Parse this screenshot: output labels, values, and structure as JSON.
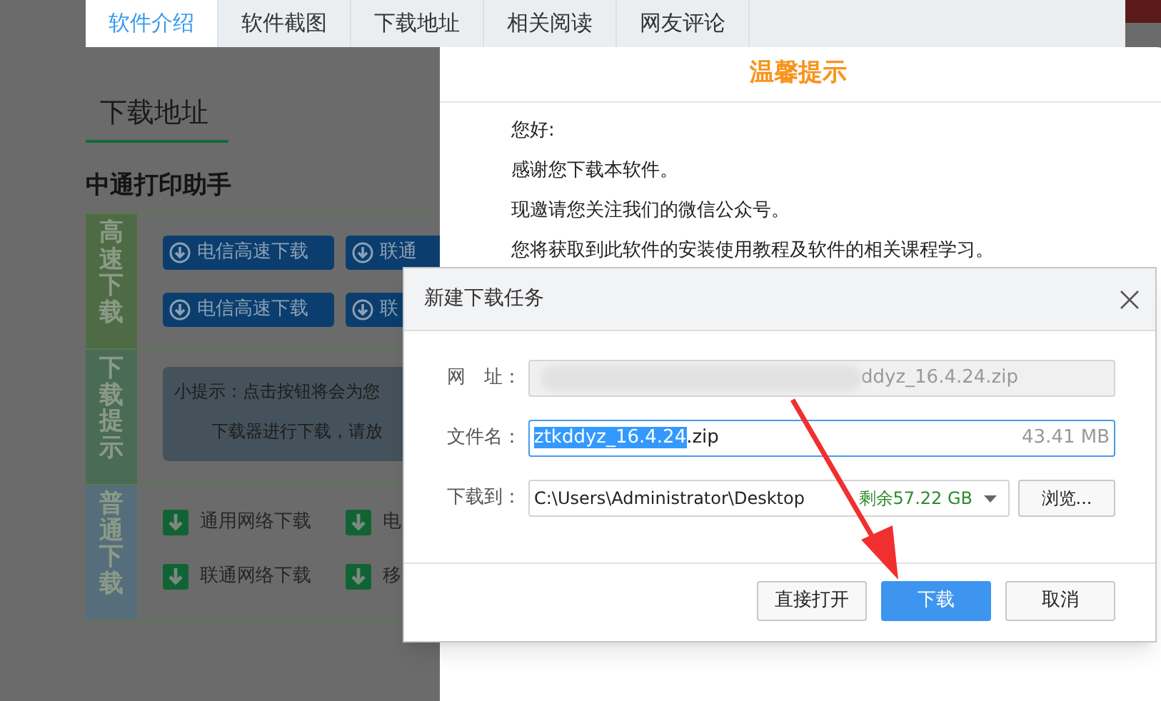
{
  "tabs": [
    {
      "label": "软件介绍",
      "selected": true
    },
    {
      "label": "软件截图",
      "selected": false
    },
    {
      "label": "下载地址",
      "selected": false
    },
    {
      "label": "相关阅读",
      "selected": false
    },
    {
      "label": "网友评论",
      "selected": false
    }
  ],
  "page": {
    "section_title": "下载地址",
    "software_name": "中通打印助手",
    "groups": [
      {
        "kind": "fast",
        "label": "高速下载",
        "color": "#4f6b45",
        "items": [
          "电信高速下载",
          "联通",
          "电信高速下载",
          "联"
        ]
      },
      {
        "kind": "tip",
        "label": "下载提示",
        "color": "#4a6b55",
        "lines": [
          "小提示：点击按钮将会为您",
          "下载器进行下载，请放"
        ]
      },
      {
        "kind": "normal",
        "label": "普通下载",
        "color": "#566d7c",
        "items": [
          "通用网络下载",
          "电",
          "联通网络下载",
          "移"
        ]
      }
    ]
  },
  "notice": {
    "title": "温馨提示",
    "lines": [
      "您好:",
      "感谢您下载本软件。",
      "现邀请您关注我们的微信公众号。",
      "您将获取到此软件的安装使用教程及软件的相关课程学习。"
    ]
  },
  "download_dialog": {
    "title": "新建下载任务",
    "url_label": "网　址：",
    "url_value": "ddyz_16.4.24.zip",
    "filename_label": "文件名：",
    "filename_selected": "ztkddyz_16.4.24",
    "filename_rest": ".zip",
    "size": "43.41 MB",
    "save_label": "下载到：",
    "save_path": "C:\\Users\\Administrator\\Desktop",
    "free_space": "剩余57.22 GB",
    "browse": "浏览...",
    "buttons": [
      {
        "label": "直接打开",
        "primary": false
      },
      {
        "label": "下载",
        "primary": true
      },
      {
        "label": "取消",
        "primary": false
      }
    ]
  }
}
